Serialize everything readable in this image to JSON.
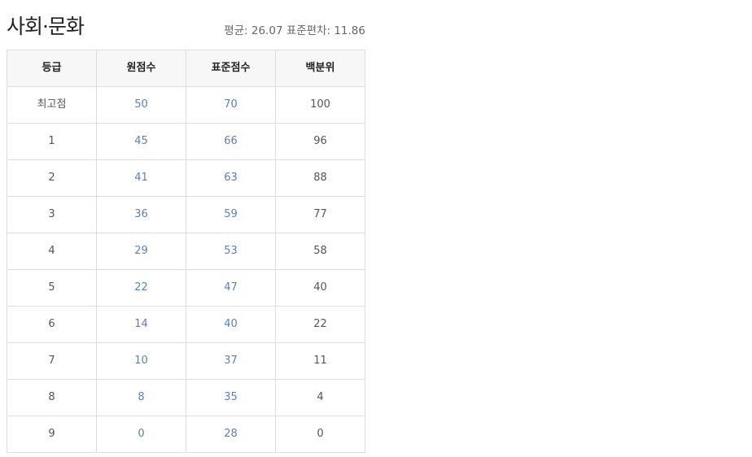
{
  "subject": {
    "title": "사회·문화",
    "stats_text": "평균: 26.07 표준편차: 11.86"
  },
  "table": {
    "headers": [
      "등급",
      "원점수",
      "표준점수",
      "백분위"
    ],
    "rows": [
      [
        "최고점",
        "50",
        "70",
        "100"
      ],
      [
        "1",
        "45",
        "66",
        "96"
      ],
      [
        "2",
        "41",
        "63",
        "88"
      ],
      [
        "3",
        "36",
        "59",
        "77"
      ],
      [
        "4",
        "29",
        "53",
        "58"
      ],
      [
        "5",
        "22",
        "47",
        "40"
      ],
      [
        "6",
        "14",
        "40",
        "22"
      ],
      [
        "7",
        "10",
        "37",
        "11"
      ],
      [
        "8",
        "8",
        "35",
        "4"
      ],
      [
        "9",
        "0",
        "28",
        "0"
      ]
    ]
  },
  "colors": {
    "link_value": "#5a7fbf",
    "header_bg": "#f7f7f7",
    "top_border": "#222222"
  }
}
